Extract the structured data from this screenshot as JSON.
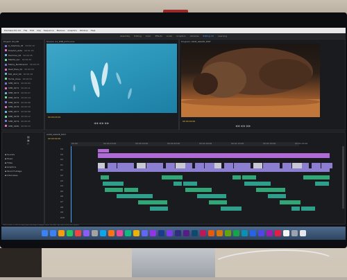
{
  "os_menu": [
    "Premiere Pro CC",
    "File",
    "Edit",
    "Clip",
    "Sequence",
    "Markers",
    "Graphics",
    "Window",
    "Help"
  ],
  "workspaces": [
    "Assembly",
    "Editing",
    "Color",
    "Effects",
    "Audio",
    "Graphics",
    "Libraries",
    "Editing CC",
    "Learning"
  ],
  "active_workspace": "Editing CC",
  "project_panel": {
    "tab": "Project: 02_DD",
    "items": [
      {
        "name": "A_dolphins_01",
        "dur": "00:00:12"
      },
      {
        "name": "Dolphin_wide",
        "dur": "00:01:03"
      },
      {
        "name": "Hammer_02",
        "dur": "00:00:45"
      },
      {
        "name": "Mantle_sec",
        "dur": "00:00:20"
      },
      {
        "name": "Manty_Nudibranch",
        "dur": "00:02:15"
      },
      {
        "name": "Reef_flare_01",
        "dur": "00:00:33"
      },
      {
        "name": "Mid_shot_04",
        "dur": "00:00:18"
      },
      {
        "name": "Turtle_close",
        "dur": "00:00:51"
      },
      {
        "name": "SHB_0171",
        "dur": "00:00:09"
      },
      {
        "name": "SHB_0172",
        "dur": "00:00:11"
      },
      {
        "name": "SHB_0173",
        "dur": "00:00:07"
      },
      {
        "name": "SHB_0174",
        "dur": "00:00:14"
      },
      {
        "name": "SHB_0175",
        "dur": "00:00:06"
      },
      {
        "name": "SHB_0176",
        "dur": "00:00:10"
      },
      {
        "name": "SHB_0177",
        "dur": "00:00:08"
      },
      {
        "name": "SHB_0178",
        "dur": "00:00:12"
      },
      {
        "name": "SHB_0179",
        "dur": "00:00:05"
      },
      {
        "name": "SHB_0180",
        "dur": "00:00:13"
      }
    ]
  },
  "source_monitor": {
    "tab": "Source: A1_SHB_0171.mov",
    "timecode": "00:00:03:02",
    "fit": "Fit"
  },
  "program_monitor": {
    "tab": "Program: 0408_GRADE_EDIT",
    "timecode": "00:00:00:00",
    "fit": "Fit"
  },
  "bins_panel": {
    "items": [
      "Sounds",
      "Music",
      "Titles",
      "Graphics",
      "Stock Footage",
      "Interviews"
    ]
  },
  "timeline": {
    "tab": "0408_GRADE_EDIT",
    "ruler": [
      "00:00",
      "00:00:15:00",
      "00:00:30:00",
      "00:00:45:00",
      "00:01:00:00",
      "00:01:15:00",
      "00:01:30:00",
      "00:01:45:00"
    ],
    "video_tracks": [
      "V4",
      "V3",
      "V2",
      "V1"
    ],
    "audio_tracks": [
      "A1",
      "A2",
      "A3",
      "A4",
      "A5",
      "A6",
      "A7",
      "A8",
      "A9",
      "A10"
    ],
    "colors": {
      "purple": "#b06ad6",
      "lavender": "#8c7fd1",
      "green": "#2fa776",
      "teal": "#2f9e8a",
      "light": "#c9c9d6"
    }
  },
  "status_bar": "Click to select, or click in empty space and drag to marquee select. Use Shift, Opt, and Cmd for other options.",
  "dock_colors": [
    "#3b82f6",
    "#3b82f6",
    "#f59e0b",
    "#22c55e",
    "#ef4444",
    "#8b5cf6",
    "#a3a3a3",
    "#0ea5e9",
    "#f97316",
    "#ec4899",
    "#10b981",
    "#eab308",
    "#6366f1",
    "#9333ea",
    "#1e3a8a",
    "#7c3aed",
    "#312e81",
    "#581c87",
    "#0c4a6e",
    "#be185d",
    "#ea580c",
    "#d97706",
    "#65a30d",
    "#16a34a",
    "#0891b2",
    "#2563eb",
    "#4f46e5",
    "#a21caf",
    "#e11d48",
    "#f5f5f5",
    "#9ca3af",
    "#e5e7eb"
  ]
}
